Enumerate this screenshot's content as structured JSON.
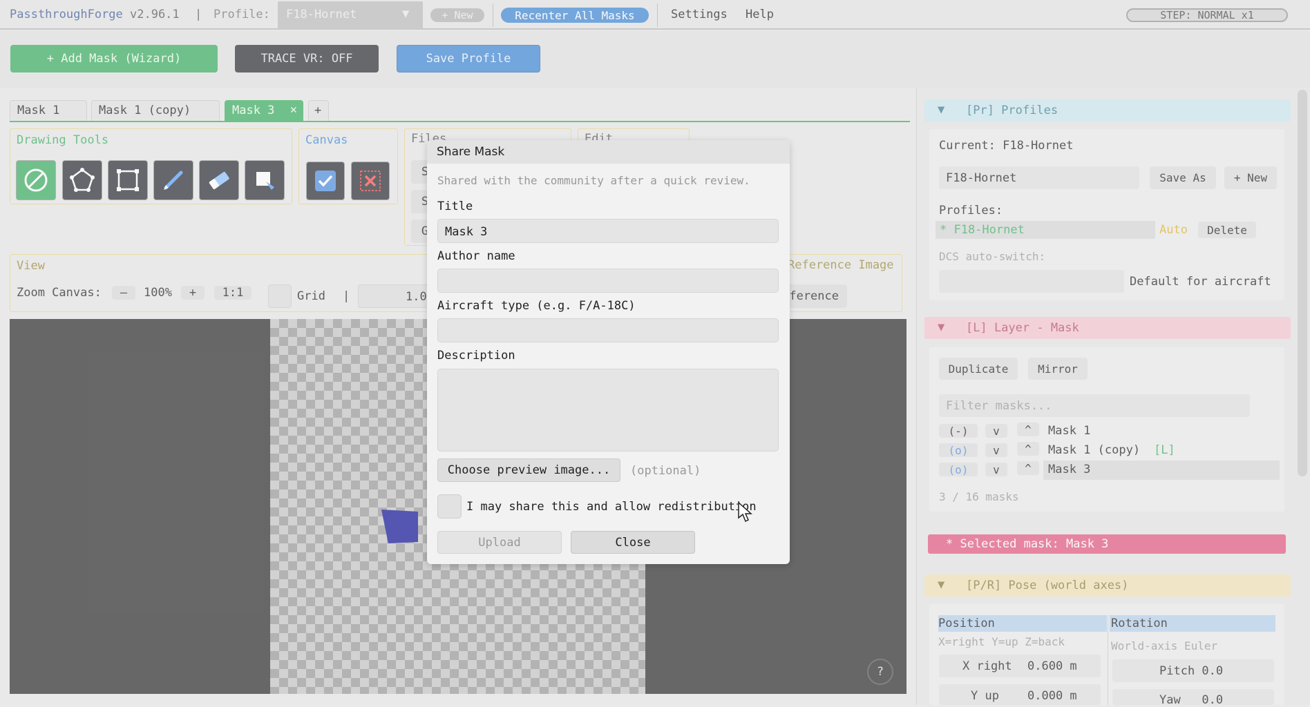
{
  "menubar": {
    "app_name": "PassthroughForge",
    "version": "v2.96.1",
    "separator": "|",
    "profile_label": "Profile:",
    "profile_value": "F18-Hornet",
    "new_label": "+ New",
    "recenter_label": "Recenter All Masks",
    "settings_label": "Settings",
    "help_label": "Help",
    "step_label": "STEP: NORMAL  x1"
  },
  "toolbar": {
    "add_mask_label": "+  Add Mask  (Wizard)",
    "trace_label": "TRACE VR: OFF",
    "save_profile_label": "Save Profile"
  },
  "tabs": [
    "Mask 1",
    "Mask 1 (copy)",
    "Mask 3",
    "+"
  ],
  "drawing_tools": {
    "title": "Drawing Tools",
    "tools": [
      "none-tool",
      "polygon-tool",
      "rectangle-tool",
      "brush-tool",
      "eraser-tool",
      "fill-tool"
    ]
  },
  "canvas_group": {
    "title": "Canvas"
  },
  "files_group": {
    "title": "Files",
    "buttons": [
      "S",
      "S",
      "G"
    ]
  },
  "edit_group": {
    "title": "Edit"
  },
  "view": {
    "title": "View",
    "zoom_label": "Zoom Canvas:",
    "zoom_minus": "–",
    "zoom_value": "100%",
    "zoom_plus": "+",
    "one_to_one": "1:1",
    "grid_label": "Grid",
    "separator": "|",
    "grid_value": "1.0",
    "reference_image_label": "Reference Image",
    "reference_button_label": "eference"
  },
  "help_button": "?",
  "right": {
    "profiles": {
      "header": "[Pr] Profiles",
      "current_label": "Current: F18-Hornet",
      "name_input": "F18-Hornet",
      "save_as": "Save As",
      "new": "+ New",
      "list_label": "Profiles:",
      "item": "* F18-Hornet",
      "auto": "Auto",
      "delete": "Delete",
      "dcs_label": "DCS auto-switch:",
      "dcs_input": "",
      "default_label": "Default for aircraft"
    },
    "layer": {
      "header": "[L] Layer - Mask",
      "duplicate": "Duplicate",
      "mirror": "Mirror",
      "filter_placeholder": "Filter masks...",
      "masks": [
        {
          "vis": "(-)",
          "down": "v",
          "up": "^",
          "name": "Mask 1",
          "tag": ""
        },
        {
          "vis": "(o)",
          "down": "v",
          "up": "^",
          "name": "Mask 1 (copy)",
          "tag": "[L]"
        },
        {
          "vis": "(o)",
          "down": "v",
          "up": "^",
          "name": "Mask 3",
          "tag": ""
        }
      ],
      "count": "3 / 16 masks"
    },
    "selected_banner": "*  Selected mask:  Mask 3",
    "pose": {
      "header": "[P/R] Pose (world axes)",
      "position_label": "Position",
      "rotation_label": "Rotation",
      "position_hint": "X=right Y=up Z=back",
      "rotation_hint": "World-axis Euler",
      "x_label": "X right",
      "x_value": "0.600 m",
      "y_label": "Y up",
      "y_value": "0.000 m",
      "pitch": "Pitch 0.0",
      "yaw": "Yaw   0.0"
    }
  },
  "dialog": {
    "title": "Share Mask",
    "subtitle": "Shared with the community after a quick review.",
    "title_label": "Title",
    "title_value": "Mask 3",
    "author_label": "Author name",
    "author_value": "",
    "aircraft_label": "Aircraft type (e.g. F/A-18C)",
    "aircraft_value": "",
    "description_label": "Description",
    "description_value": "",
    "preview_button": "Choose preview image...",
    "optional": "(optional)",
    "consent_label": "I may share this and allow redistribution",
    "upload": "Upload",
    "close": "Close"
  },
  "colors": {
    "accent_green": "#3cae62",
    "accent_blue": "#3f88d6",
    "profiles_header": "#cde9ef",
    "layer_header": "#f6c6d2",
    "pose_header": "#f3e4b8",
    "selected_banner": "#e45a82",
    "mask_fill": "#15159a"
  }
}
